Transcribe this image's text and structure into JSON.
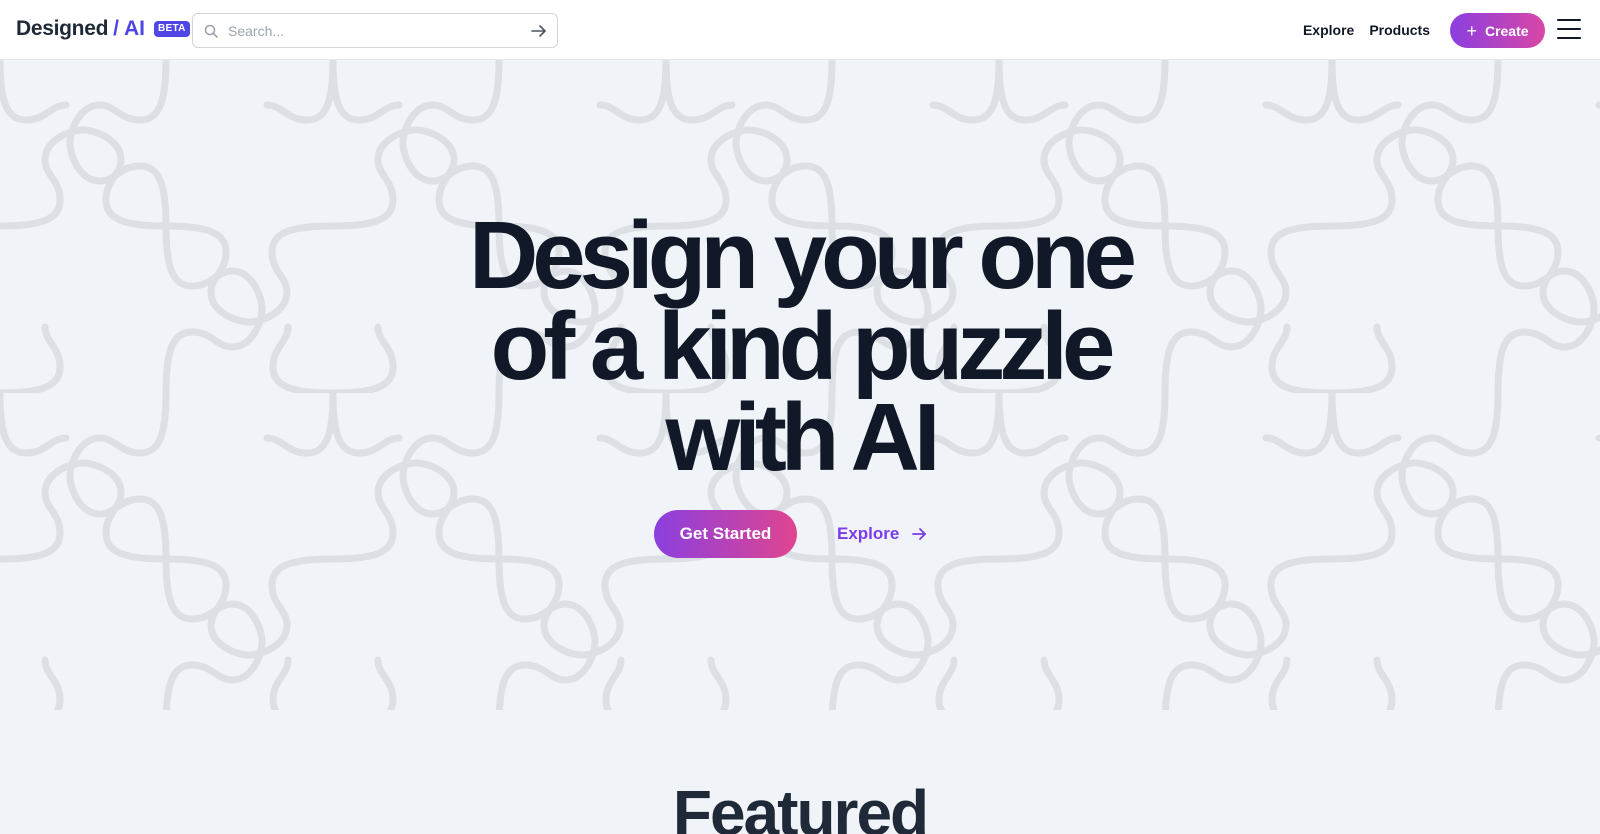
{
  "header": {
    "logo": {
      "name": "Designed",
      "accent": "/ AI",
      "badge": "BETA"
    },
    "search": {
      "placeholder": "Search..."
    },
    "nav": [
      "Explore",
      "Products"
    ],
    "create_label": "Create",
    "create_icon": "plus-icon",
    "menu_icon": "hamburger-menu-icon"
  },
  "hero": {
    "title_lines": [
      "Design your one",
      "of a kind puzzle",
      "with AI"
    ],
    "primary_cta": "Get Started",
    "secondary_cta": "Explore",
    "secondary_icon": "arrow-right-icon"
  },
  "featured": {
    "title": "Featured"
  },
  "colors": {
    "brand": "#4f46e5",
    "gradient_start": "#8b3fe0",
    "gradient_end": "#d946a6",
    "link": "#7c3aed",
    "background": "#f0f4f8",
    "pattern": "#dcdfe3",
    "text": "#111827"
  }
}
